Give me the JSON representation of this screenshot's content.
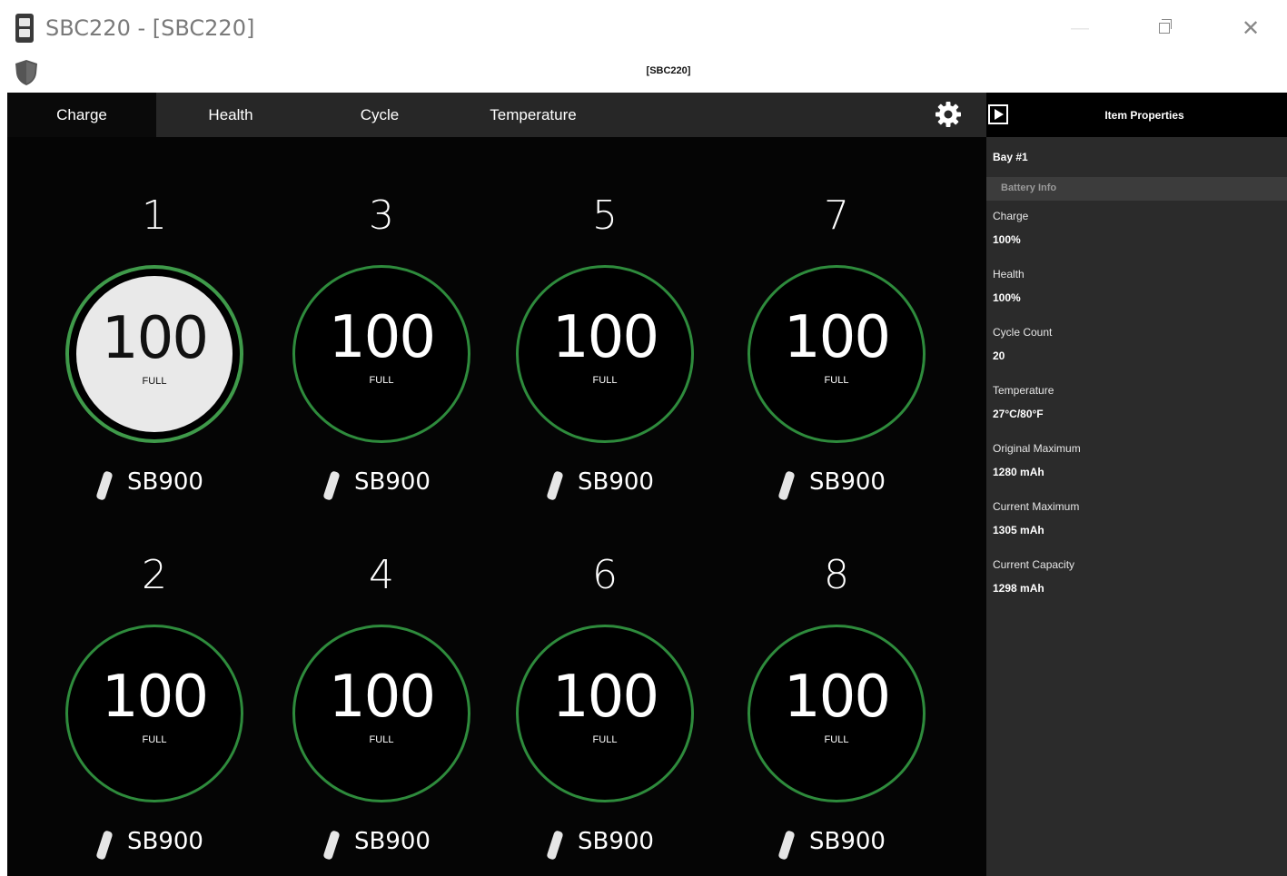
{
  "window": {
    "title": "SBC220 - [SBC220]",
    "subtitle": "[SBC220]",
    "minimize_glyph": "—",
    "close_glyph": "✕"
  },
  "tabs": [
    {
      "label": "Charge",
      "active": true
    },
    {
      "label": "Health",
      "active": false
    },
    {
      "label": "Cycle",
      "active": false
    },
    {
      "label": "Temperature",
      "active": false
    }
  ],
  "bays": [
    {
      "number": "1",
      "value": "100",
      "status": "FULL",
      "model": "SB900",
      "selected": true
    },
    {
      "number": "3",
      "value": "100",
      "status": "FULL",
      "model": "SB900",
      "selected": false
    },
    {
      "number": "5",
      "value": "100",
      "status": "FULL",
      "model": "SB900",
      "selected": false
    },
    {
      "number": "7",
      "value": "100",
      "status": "FULL",
      "model": "SB900",
      "selected": false
    },
    {
      "number": "2",
      "value": "100",
      "status": "FULL",
      "model": "SB900",
      "selected": false
    },
    {
      "number": "4",
      "value": "100",
      "status": "FULL",
      "model": "SB900",
      "selected": false
    },
    {
      "number": "6",
      "value": "100",
      "status": "FULL",
      "model": "SB900",
      "selected": false
    },
    {
      "number": "8",
      "value": "100",
      "status": "FULL",
      "model": "SB900",
      "selected": false
    }
  ],
  "properties": {
    "title": "Item Properties",
    "bay": "Bay #1",
    "section": "Battery Info",
    "items": [
      {
        "label": "Charge",
        "value": "100%"
      },
      {
        "label": "Health",
        "value": "100%"
      },
      {
        "label": "Cycle Count",
        "value": "20"
      },
      {
        "label": "Temperature",
        "value": "27°C/80°F"
      },
      {
        "label": "Original Maximum",
        "value": "1280 mAh"
      },
      {
        "label": "Current Maximum",
        "value": "1305 mAh"
      },
      {
        "label": "Current Capacity",
        "value": "1298 mAh"
      }
    ]
  },
  "colors": {
    "gauge_ring": "#2e8b3c",
    "background": "#050505",
    "tab_bar": "#272727",
    "panel": "#2b2b2b"
  },
  "icons": [
    "app-icon",
    "shield-icon",
    "gear-icon",
    "play-icon",
    "battery-icon"
  ]
}
